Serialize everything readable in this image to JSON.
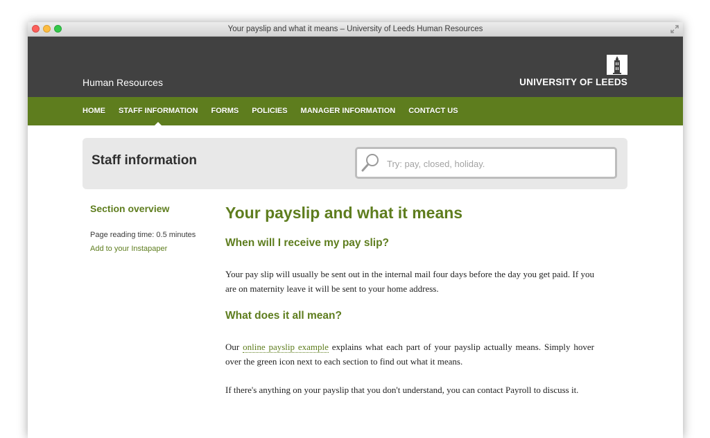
{
  "window": {
    "title": "Your payslip and what it means – University of Leeds Human Resources"
  },
  "header": {
    "site_name": "Human Resources",
    "logo_text": "UNIVERSITY OF LEEDS"
  },
  "nav": {
    "items": [
      {
        "label": "HOME"
      },
      {
        "label": "STAFF INFORMATION",
        "active": true
      },
      {
        "label": "FORMS"
      },
      {
        "label": "POLICIES"
      },
      {
        "label": "MANAGER INFORMATION"
      },
      {
        "label": "CONTACT US"
      }
    ]
  },
  "page_head": {
    "title": "Staff information",
    "search_placeholder": "Try: pay, closed, holiday.",
    "search_icon": "search-icon"
  },
  "sidebar": {
    "heading": "Section overview",
    "reading_time": "Page reading time: 0.5 minutes",
    "instapaper_link": "Add to your Instapaper"
  },
  "article": {
    "title": "Your payslip and what it means",
    "section1_heading": "When will I receive my pay slip?",
    "section1_text": "Your pay slip will usually be sent out in the internal mail four days before the day you get paid. If you are on maternity leave it will be sent to your home address.",
    "section2_heading": "What does it all mean?",
    "section2_text_before": "Our ",
    "section2_link": "online payslip example",
    "section2_text_after": " explains what each part of your payslip actually means. Simply hover over the green icon next to each section to find out what it means.",
    "section3_text": "If there's anything on your payslip that you don't understand, you can contact Payroll to discuss it."
  },
  "colors": {
    "header_bg": "#414141",
    "nav_bg": "#5e7d1e",
    "accent_green": "#5e7d1e",
    "panel_bg": "#e8e8e8"
  }
}
